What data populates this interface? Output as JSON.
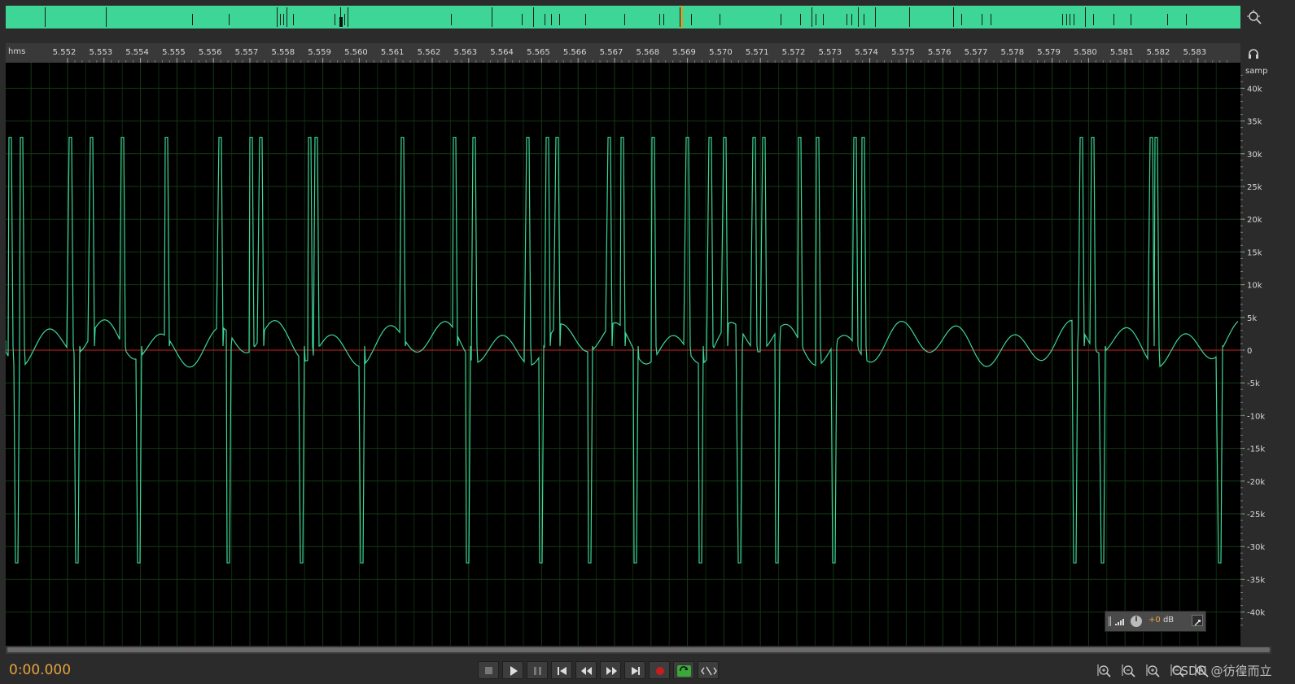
{
  "ruler": {
    "unit": "hms",
    "ticks": [
      "5.552",
      "5.553",
      "5.554",
      "5.555",
      "5.556",
      "5.557",
      "5.558",
      "5.559",
      "5.560",
      "5.561",
      "5.562",
      "5.563",
      "5.564",
      "5.565",
      "5.566",
      "5.567",
      "5.568",
      "5.569",
      "5.570",
      "5.571",
      "5.572",
      "5.573",
      "5.574",
      "5.575",
      "5.576",
      "5.577",
      "5.578",
      "5.579",
      "5.580",
      "5.581",
      "5.582",
      "5.583"
    ]
  },
  "amplitude_scale": {
    "unit": "samp",
    "labels": [
      "40k",
      "35k",
      "30k",
      "25k",
      "20k",
      "15k",
      "10k",
      "5k",
      "0",
      "-5k",
      "-10k",
      "-15k",
      "-20k",
      "-25k",
      "-30k",
      "-35k",
      "-40k"
    ]
  },
  "transport": {
    "time": "0:00.000",
    "buttons": [
      "stop-icon",
      "play-icon",
      "pause-icon",
      "go-to-start-icon",
      "rewind-icon",
      "fast-forward-icon",
      "go-to-end-icon",
      "record-icon",
      "loop-icon",
      "skip-selection-icon"
    ]
  },
  "hud": {
    "plus": "+0",
    "unit": "dB"
  },
  "zoom_buttons": [
    "zoom-in-amplitude-icon",
    "zoom-out-amplitude-icon",
    "zoom-in-time-icon",
    "zoom-out-time-icon",
    "zoom-full-icon"
  ],
  "watermark": "CSDN @彷徨而立",
  "colors": {
    "waveform": "#3dd696",
    "overview": "#3dd696",
    "zero_line": "#d02020",
    "grid": "#123d12",
    "time_display": "#e8a33d"
  }
}
